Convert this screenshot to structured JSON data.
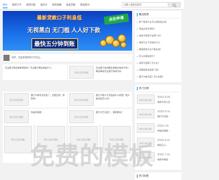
{
  "nav": {
    "items": [
      "首页",
      "网贷口子",
      "网贷问答",
      "信用卡",
      "网贷攻略",
      "免息贷款",
      "财经知识"
    ],
    "active_index": 0
  },
  "search": {
    "placeholder": "请输入搜索关键词"
  },
  "banner": {
    "line1": "最新贷款口子利息低",
    "badge": "点击申请",
    "line2": "无视黑白  无门槛  人人好下款",
    "line3": "最快五分钟到账"
  },
  "notice": {
    "text": "你好，欢迎来到网贷口子论坛。"
  },
  "placeholder_image": "暂时无法显示图片",
  "posts": [
    {
      "title": "农业银行黑名单能借钱吗？农业银行黑名单是什么…"
    },
    {
      "title": "农业银行信用黑名单能办信用卡吗？黑名单和农业银行信用卡的…"
    },
    {
      "title": "银行卡被司法冻结了，还能还款、借款吗？"
    },
    {
      "title": "银行卡账户已冻结是什么原因？账户被冻结怎么办？"
    },
    {
      "title": "你信贷客服…"
    },
    {
      "title": "银行卡已冻结了，能转账吗？"
    }
  ],
  "features": [
    {
      "image_text": "暂时无法显示图片"
    },
    {
      "image_text": "暂时无法显示图片"
    },
    {
      "image_text": "暂时无法显示图片"
    },
    {
      "image_text": "暂时无法显示图片"
    }
  ],
  "watermark": "免费的模板",
  "sidebar": {
    "latest": {
      "title": "最近发表",
      "items": [
        "那个借款平台可以借到钱急用…",
        "现金白条靠谱吗？",
        "信用卡借款平台哪个好？",
        "借款平台下款快的口子…",
        "哪些借款平台不看征信？",
        "怎么办理信用卡？",
        "信用卡逾期了怎么办？",
        "有哪些网贷容易下款？",
        "银行卡被冻结了怎么处理？"
      ]
    },
    "hot": {
      "title": "热门文章",
      "items": [
        {
          "date": "2022.9.28",
          "title": "信用卡怎么还…"
        },
        {
          "date": "2022.8.14",
          "title": "银行卡冻结…"
        },
        {
          "date": "2022.4.6",
          "title": "你信贷客服…"
        },
        {
          "date": "2022.8.11",
          "title": "网贷口子…"
        },
        {
          "date": "2022.7.31",
          "title": "信用卡额度…"
        }
      ]
    },
    "tags": {
      "title": "热门标签"
    }
  }
}
